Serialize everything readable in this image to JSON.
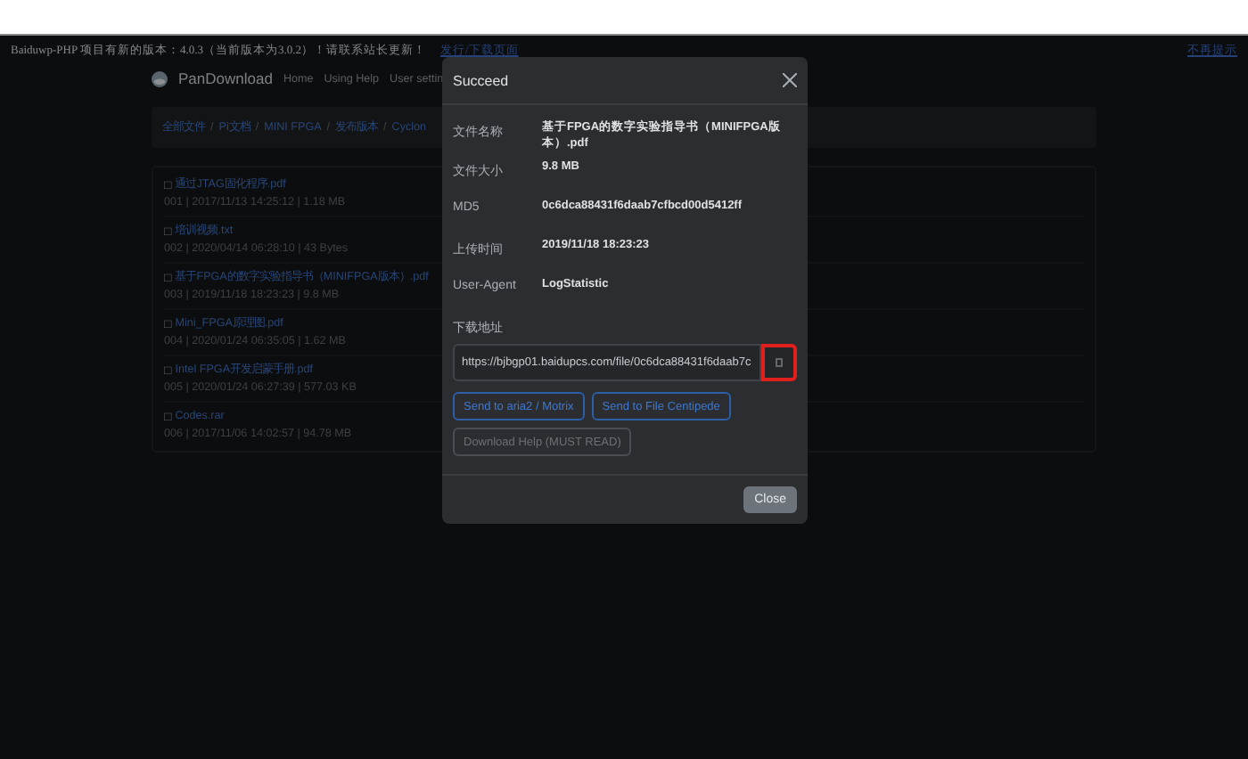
{
  "notice": {
    "text": "Baiduwp-PHP 项目有新的版本：4.0.3（当前版本为3.0.2）！请联系站长更新！",
    "link": "发行/下载页面",
    "dismiss": "不再提示"
  },
  "navbar": {
    "brand": "PanDownload",
    "links": [
      "Home",
      "Using Help",
      "User settin"
    ]
  },
  "breadcrumb": [
    {
      "label": "全部文件"
    },
    {
      "separator": "/",
      "label": "Pi文档"
    },
    {
      "separator": "/",
      "label": "MINI FPGA"
    },
    {
      "separator": "/",
      "label": "发布版本"
    },
    {
      "separator": "/",
      "label": "Cyclon"
    }
  ],
  "files": [
    {
      "marker": "□",
      "name": "通过JTAG固化程序.pdf",
      "meta": "001 | 2017/11/13 14:25:12 | 1.18 MB"
    },
    {
      "marker": "□",
      "name": "培训视频.txt",
      "meta": "002 | 2020/04/14 06:28:10 | 43 Bytes"
    },
    {
      "marker": "□",
      "name": "基于FPGA的数字实验指导书（MINIFPGA版本）.pdf",
      "meta": "003 | 2019/11/18 18:23:23 | 9.8 MB"
    },
    {
      "marker": "□",
      "name": "Mini_FPGA原理图.pdf",
      "meta": "004 | 2020/01/24 06:35:05 | 1.62 MB"
    },
    {
      "marker": "□",
      "name": "Intel FPGA开发启蒙手册.pdf",
      "meta": "005 | 2020/01/24 06:27:39 | 577.03 KB"
    },
    {
      "marker": "□",
      "name": "Codes.rar",
      "meta": "006 | 2017/11/06 14:02:57 | 94.78 MB"
    }
  ],
  "modal": {
    "title": "Succeed",
    "fields": [
      {
        "label": "文件名称",
        "value": "基于FPGA的数字实验指导书（MINIFPGA版本）.pdf"
      },
      {
        "label": "文件大小",
        "value": "9.8 MB"
      },
      {
        "label": "MD5",
        "value": "0c6dca88431f6daab7cfbcd00d5412ff"
      },
      {
        "label": "上传时间",
        "value": "2019/11/18 18:23:23"
      },
      {
        "label": "User-Agent",
        "value": "LogStatistic"
      }
    ],
    "link_label": "下载地址",
    "link_value": "https://bjbgp01.baidupcs.com/file/0c6dca88431f6daab7c",
    "copy_highlighted": true,
    "buttons": [
      {
        "label": "Send to aria2 / Motrix",
        "kind": "primary"
      },
      {
        "label": "Send to File Centipede",
        "kind": "primary"
      },
      {
        "label": "Download Help (MUST READ)",
        "kind": "muted"
      }
    ],
    "close": "Close"
  }
}
